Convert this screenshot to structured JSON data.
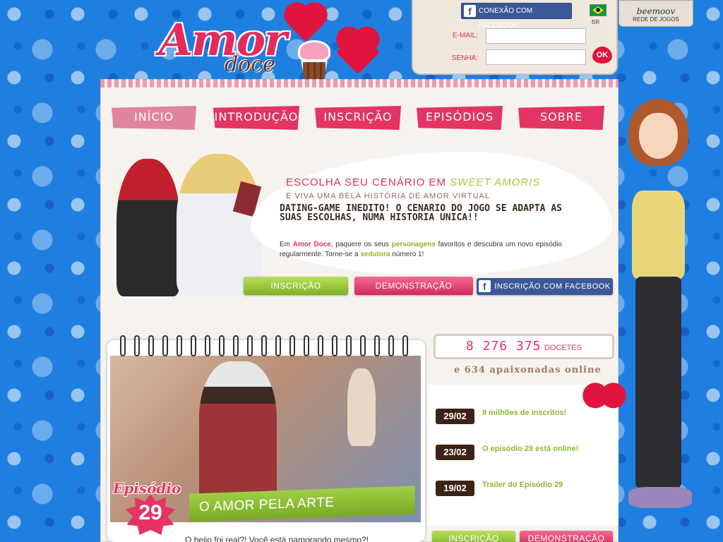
{
  "logo": {
    "word1": "Amor",
    "word2": "doce"
  },
  "login": {
    "facebook_label": "CONEXÃO COM FACEBOOK",
    "country": "BR",
    "email_label": "E-MAIL:",
    "password_label": "SENHA:",
    "ok_label": "OK"
  },
  "network": {
    "name": "beemoov",
    "subtitle": "REDE DE JOGOS"
  },
  "nav": {
    "items": [
      {
        "label": "INÍCIO"
      },
      {
        "label": "INTRODUÇÃO"
      },
      {
        "label": "INSCRIÇÃO"
      },
      {
        "label": "EPISÓDIOS"
      },
      {
        "label": "SOBRE"
      }
    ]
  },
  "hero": {
    "headline_prefix": "ESCOLHA SEU CENÁRIO EM",
    "headline_highlight": "SWEET AMORIS",
    "subheadline": "E VIVA UMA BELA HISTÓRIA DE AMOR VIRTUAL",
    "body": "DATING-GAME INEDITO! O CENARIO DO JOGO SE ADAPTA AS SUAS ESCOLHAS, NUMA HISTORIA UNICA!!",
    "small_p1": "Em",
    "small_brand": "Amor Doce",
    "small_p2": ", paquere os seus",
    "small_characters": "personagens",
    "small_p3": "favoritos e descubra um novo episódio regularmente. Torne-se a",
    "small_seductress": "sedutora",
    "small_p4": "número 1!",
    "btn_signup": "INSCRIÇÃO",
    "btn_demo": "DEMONSTRAÇÃO",
    "btn_facebook": "INSCRIÇÃO COM FACEBOOK"
  },
  "episode": {
    "label": "Episódio",
    "number": "29",
    "title": "O AMOR PELA ARTE",
    "teaser": "O beijo foi real?! Você está namorando mesmo?!"
  },
  "stats": {
    "count": "8 276 375",
    "unit": "DOCETES",
    "online": "e 634 apaixonadas online"
  },
  "news": [
    {
      "date": "29/02",
      "text": "8 milhões de inscritos!"
    },
    {
      "date": "23/02",
      "text": "O episódio 29 está online!"
    },
    {
      "date": "19/02",
      "text": "Trailer do Episódio 29"
    }
  ],
  "bottom_buttons": {
    "signup": "INSCRIÇÃO",
    "demo": "DEMONSTRAÇÃO"
  },
  "colors": {
    "brand_pink": "#e33464",
    "accent_green": "#8cb830",
    "background_blue": "#1f7fe0",
    "facebook_blue": "#3b5998"
  }
}
